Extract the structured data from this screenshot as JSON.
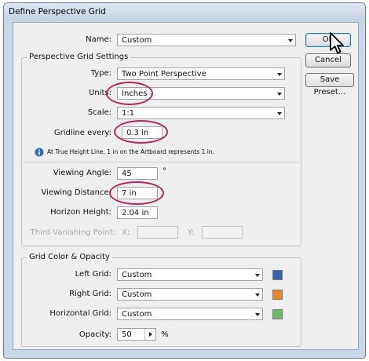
{
  "window": {
    "title": "Define Perspective Grid"
  },
  "name": {
    "label": "Name:",
    "value": "Custom"
  },
  "buttons": {
    "ok": "OK",
    "cancel": "Cancel",
    "save_preset": "Save Preset..."
  },
  "grid_settings": {
    "legend": "Perspective Grid Settings",
    "type": {
      "label": "Type:",
      "value": "Two Point Perspective"
    },
    "units": {
      "label": "Units:",
      "value": "Inches"
    },
    "scale": {
      "label": "Scale:",
      "value": "1:1"
    },
    "gridline": {
      "label": "Gridline every:",
      "value": "0.3 in"
    },
    "info_text": "At True Height Line, 1 in on the Artboard represents 1 in.",
    "viewing_angle": {
      "label": "Viewing Angle:",
      "value": "45",
      "unit": "°"
    },
    "viewing_distance": {
      "label": "Viewing Distance:",
      "value": "7 in"
    },
    "horizon_height": {
      "label": "Horizon Height:",
      "value": "2.04 in"
    },
    "third_vp": {
      "label": "Third Vanishing Point:",
      "x_label": "X:",
      "y_label": "Y:"
    }
  },
  "color_opacity": {
    "legend": "Grid Color & Opacity",
    "left_grid": {
      "label": "Left Grid:",
      "value": "Custom",
      "color": "#3a5fb0"
    },
    "right_grid": {
      "label": "Right Grid:",
      "value": "Custom",
      "color": "#e8862a"
    },
    "horizontal_grid": {
      "label": "Horizontal Grid:",
      "value": "Custom",
      "color": "#6fb96a"
    },
    "opacity": {
      "label": "Opacity:",
      "value": "50",
      "unit": "%"
    }
  },
  "colors": {
    "highlight_circle": "#b3265f"
  }
}
